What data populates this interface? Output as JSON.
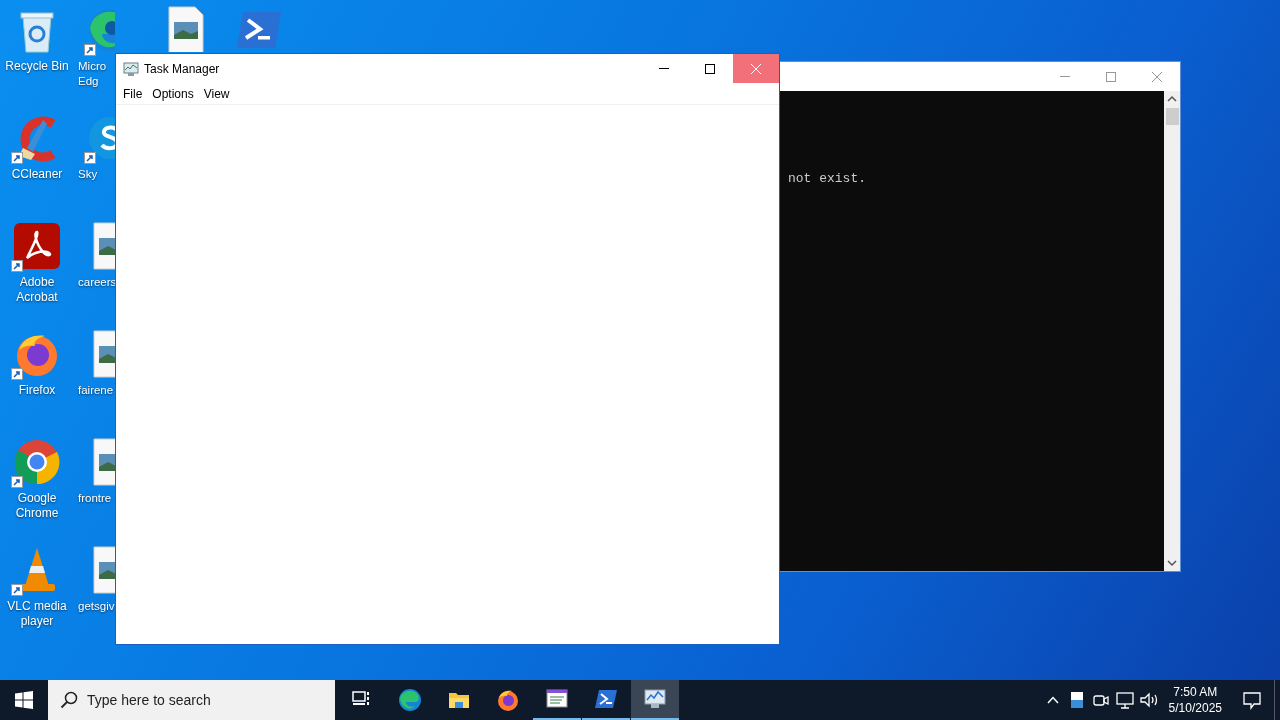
{
  "desktop": {
    "icon_columns": [
      [
        {
          "kind": "recycle-bin",
          "label": "Recycle Bin",
          "shortcut": false
        },
        {
          "kind": "ccleaner",
          "label": "CCleaner",
          "shortcut": true
        },
        {
          "kind": "pdf",
          "label": "Adobe Acrobat",
          "shortcut": true
        },
        {
          "kind": "firefox",
          "label": "Firefox",
          "shortcut": true
        },
        {
          "kind": "chrome",
          "label": "Google Chrome",
          "shortcut": true
        },
        {
          "kind": "vlc",
          "label": "VLC media player",
          "shortcut": true
        }
      ],
      [
        {
          "kind": "edge",
          "label": "Micro\nEdg",
          "shortcut": true
        },
        {
          "kind": "skype",
          "label": "Sky",
          "shortcut": true
        },
        {
          "kind": "image-file",
          "label": "careers",
          "shortcut": false
        },
        {
          "kind": "image-file",
          "label": "fairene",
          "shortcut": false
        },
        {
          "kind": "image-file",
          "label": "frontre",
          "shortcut": false
        },
        {
          "kind": "image-file",
          "label": "getsgiv",
          "shortcut": false
        }
      ],
      [
        {
          "kind": "image-file",
          "shortcut": false
        }
      ],
      [
        {
          "kind": "powershell",
          "shortcut": false
        }
      ]
    ]
  },
  "console_window": {
    "output_lines": [
      "not exist."
    ]
  },
  "task_manager": {
    "title": "Task Manager",
    "menu": [
      "File",
      "Options",
      "View"
    ],
    "close_hovered": true
  },
  "taskbar": {
    "search": {
      "placeholder": "Type here to search"
    },
    "apps": [
      {
        "kind": "task-view",
        "running": false,
        "selected": false
      },
      {
        "kind": "edge",
        "running": false,
        "selected": false
      },
      {
        "kind": "explorer",
        "running": false,
        "selected": false
      },
      {
        "kind": "firefox",
        "running": false,
        "selected": false
      },
      {
        "kind": "viewer",
        "running": true,
        "selected": false
      },
      {
        "kind": "powershell",
        "running": true,
        "selected": false
      },
      {
        "kind": "taskmgr",
        "running": true,
        "selected": true
      }
    ],
    "time": "7:50 AM",
    "date": "5/10/2025"
  }
}
